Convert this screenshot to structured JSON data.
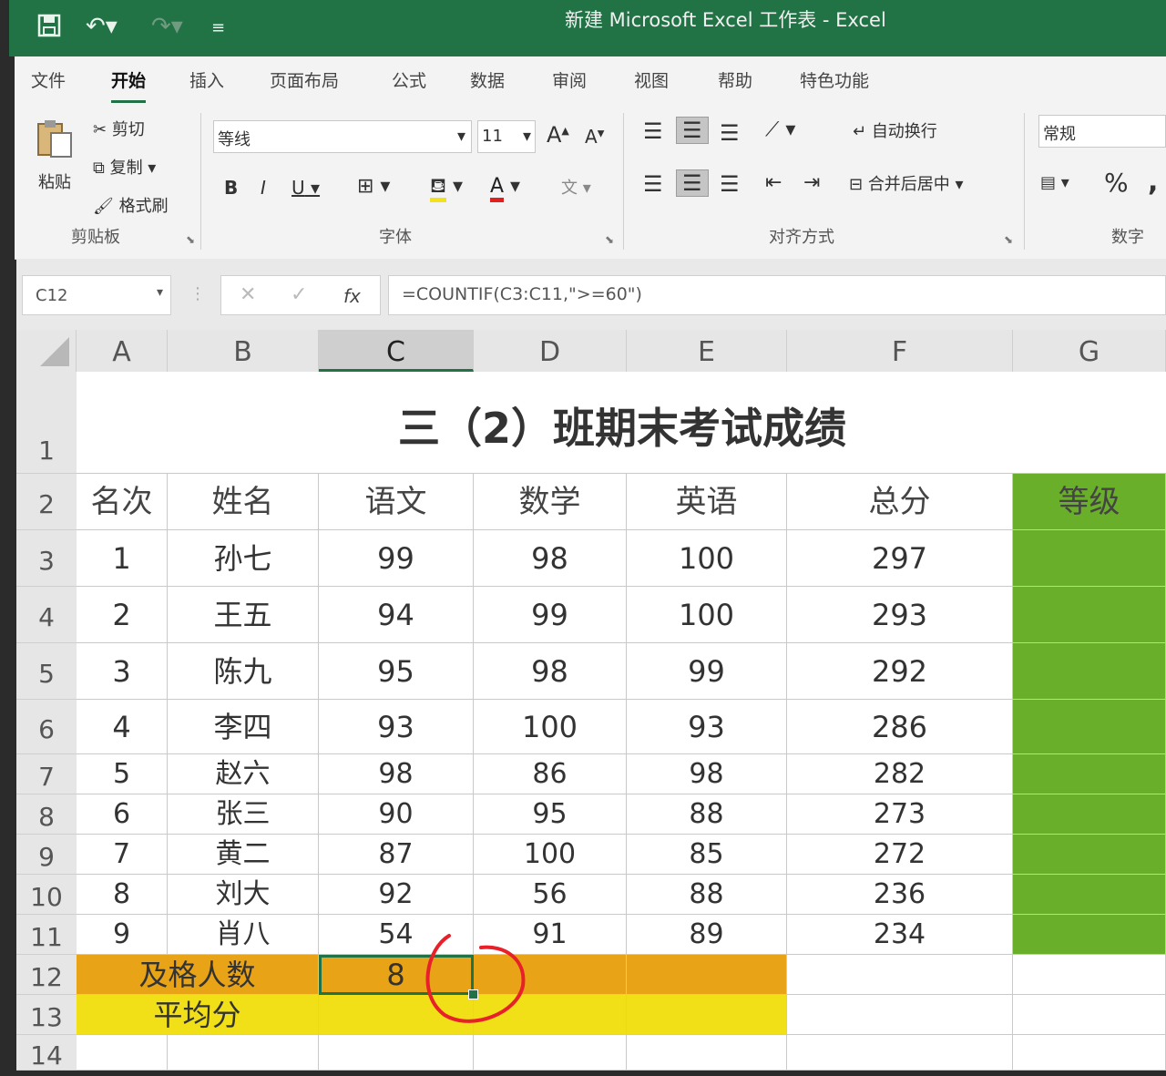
{
  "window": {
    "title": "新建 Microsoft Excel 工作表  -  Excel"
  },
  "menu": {
    "tabs": [
      "文件",
      "开始",
      "插入",
      "页面布局",
      "公式",
      "数据",
      "审阅",
      "视图",
      "帮助",
      "特色功能"
    ],
    "active": "开始"
  },
  "ribbon": {
    "clipboard": {
      "paste": "粘贴",
      "cut": "剪切",
      "copy": "复制",
      "format_painter": "格式刷",
      "label": "剪贴板"
    },
    "font": {
      "family": "等线",
      "size": "11",
      "bold": "B",
      "italic": "I",
      "underline": "U",
      "grow": "A",
      "shrink": "A",
      "font_color": "A",
      "label": "字体"
    },
    "alignment": {
      "wrap_text": "自动换行",
      "merge_center": "合并后居中",
      "label": "对齐方式"
    },
    "number": {
      "format": "常规",
      "percent": "%",
      "label": "数字"
    }
  },
  "formula_bar": {
    "name_box": "C12",
    "fx": "fx",
    "formula": "=COUNTIF(C3:C11,\">=60\")"
  },
  "sheet": {
    "columns": [
      "A",
      "B",
      "C",
      "D",
      "E",
      "F",
      "G"
    ],
    "selected_column": "C",
    "row_numbers": [
      "1",
      "2",
      "3",
      "4",
      "5",
      "6",
      "7",
      "8",
      "9",
      "10",
      "11",
      "12",
      "13",
      "14"
    ],
    "title": "三（2）班期末考试成绩",
    "headers": [
      "名次",
      "姓名",
      "语文",
      "数学",
      "英语",
      "总分",
      "等级"
    ],
    "rows": [
      [
        "1",
        "孙七",
        "99",
        "98",
        "100",
        "297"
      ],
      [
        "2",
        "王五",
        "94",
        "99",
        "100",
        "293"
      ],
      [
        "3",
        "陈九",
        "95",
        "98",
        "99",
        "292"
      ],
      [
        "4",
        "李四",
        "93",
        "100",
        "93",
        "286"
      ],
      [
        "5",
        "赵六",
        "98",
        "86",
        "98",
        "282"
      ],
      [
        "6",
        "张三",
        "90",
        "95",
        "88",
        "273"
      ],
      [
        "7",
        "黄二",
        "87",
        "100",
        "85",
        "272"
      ],
      [
        "8",
        "刘大",
        "92",
        "56",
        "88",
        "236"
      ],
      [
        "9",
        "肖八",
        "54",
        "91",
        "89",
        "234"
      ]
    ],
    "pass_count_label": "及格人数",
    "pass_count_value": "8",
    "average_label": "平均分",
    "colors": {
      "grade_fill": "#6aaf2a",
      "pass_row": "#e8a317",
      "avg_row": "#f1df18",
      "accent": "#217346"
    }
  }
}
